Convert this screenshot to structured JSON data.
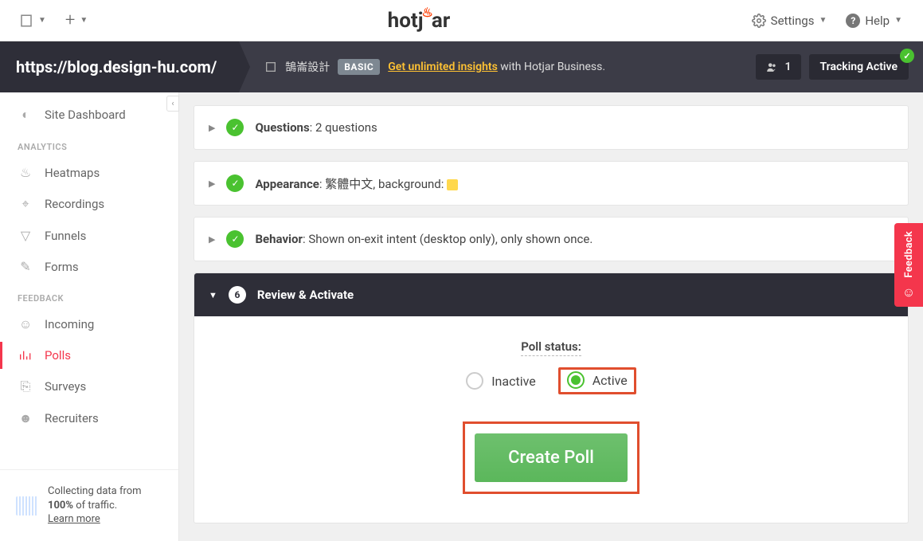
{
  "topbar": {
    "settings": "Settings",
    "help": "Help"
  },
  "darkbar": {
    "url": "https://blog.design-hu.com/",
    "site_name": "鵠崙設計",
    "plan_badge": "BASIC",
    "upgrade_link": "Get unlimited insights",
    "upgrade_rest": " with Hotjar Business.",
    "user_count": "1",
    "tracking": "Tracking Active"
  },
  "sidebar": {
    "dashboard": "Site Dashboard",
    "section_analytics": "ANALYTICS",
    "heatmaps": "Heatmaps",
    "recordings": "Recordings",
    "funnels": "Funnels",
    "forms": "Forms",
    "section_feedback": "FEEDBACK",
    "incoming": "Incoming",
    "polls": "Polls",
    "surveys": "Surveys",
    "recruiters": "Recruiters",
    "foot_line1": "Collecting data from",
    "foot_line2a": "100%",
    "foot_line2b": " of traffic.",
    "foot_learn": "Learn more"
  },
  "steps": {
    "questions_label": "Questions",
    "questions_detail": ": 2 questions",
    "appearance_label": "Appearance",
    "appearance_detail": ": 繁體中文, background: ",
    "behavior_label": "Behavior",
    "behavior_detail": ": Shown on-exit intent (desktop only), only shown once.",
    "review_num": "6",
    "review_label": "Review & Activate"
  },
  "body": {
    "status_label": "Poll status:",
    "inactive": "Inactive",
    "active": "Active",
    "create": "Create Poll"
  },
  "feedback_tab": "Feedback"
}
